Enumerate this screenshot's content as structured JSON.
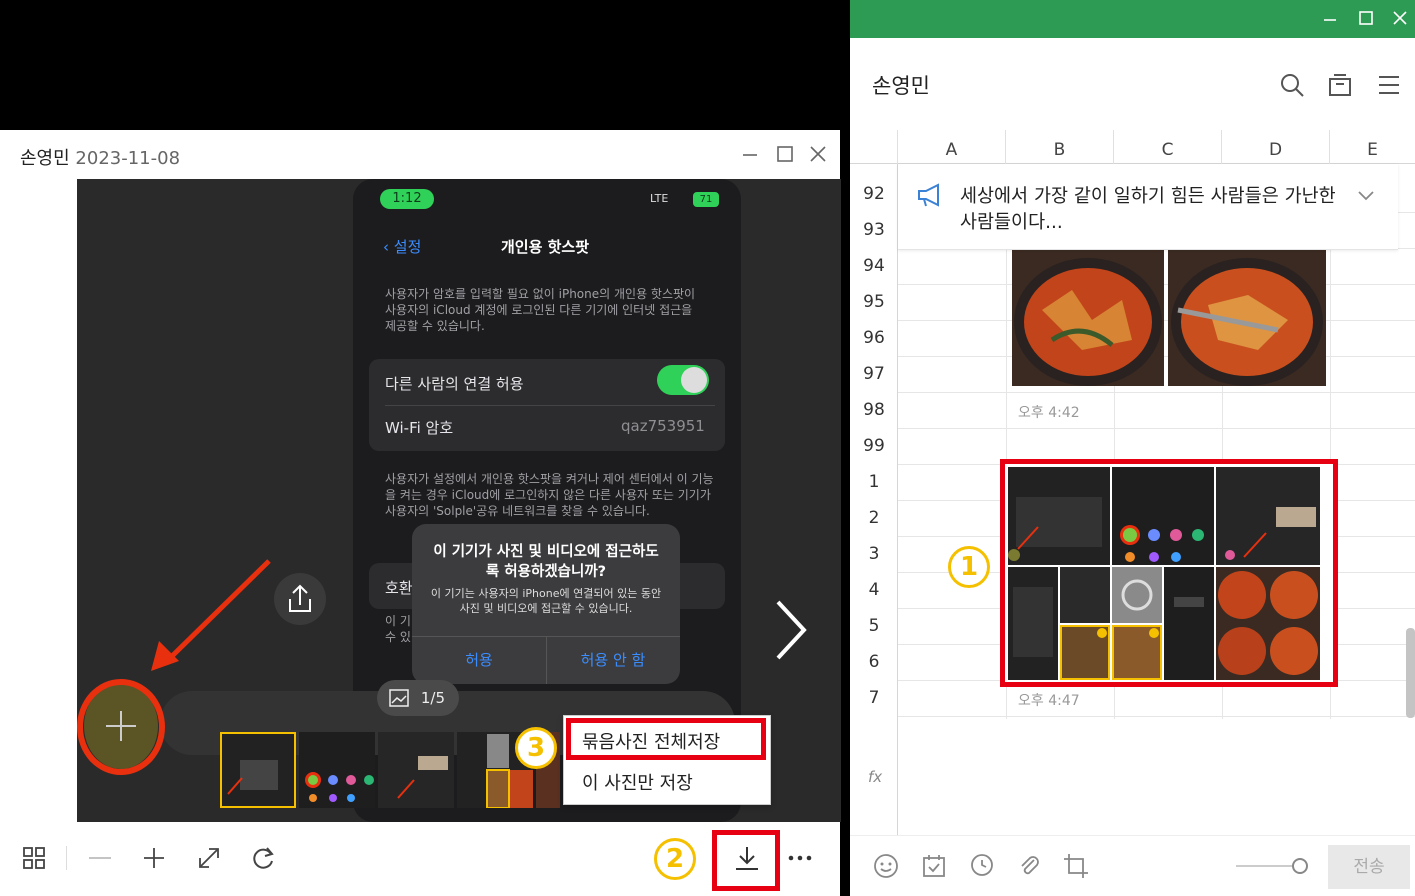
{
  "chat": {
    "name": "손영민",
    "columns": [
      "A",
      "B",
      "C",
      "D",
      "E"
    ],
    "rows": [
      "92",
      "93",
      "94",
      "95",
      "96",
      "97",
      "98",
      "99",
      "1",
      "2",
      "3",
      "4",
      "5",
      "6",
      "7"
    ],
    "notice": "세상에서 가장 같이 일하기 힘든 사람들은 가난한 사람들이다...",
    "time1": "오후 4:42",
    "time2": "오후 4:47",
    "formula_label": "fx",
    "send_label": "전송",
    "marker": "1"
  },
  "viewer": {
    "name": "손영민",
    "date": "2023-11-08",
    "counter": "1/5",
    "marker2": "2",
    "marker3": "3",
    "menu": [
      "묶음사진 전체저장",
      "이 사진만 저장"
    ],
    "phone": {
      "time": "1:12",
      "network": "LTE",
      "battery": "71",
      "back": "설정",
      "title": "개인용 핫스팟",
      "desc1": "사용자가 암호를 입력할 필요 없이 iPhone의 개인용 핫스팟이 사용자의 iCloud 계정에 로그인된 다른 기기에 인터넷 접근을 제공할 수 있습니다.",
      "row1": "다른 사람의 연결 허용",
      "row2": "Wi-Fi 암호",
      "row2_value": "qaz753951",
      "desc2": "사용자가 설정에서 개인용 핫스팟을 켜거나 제어 센터에서 이 기능을 켜는 경우 iCloud에 로그인하지 않은 다른 사용자 또는 기기가 사용자의 'Solple'공유 네트워크를 찾을 수 있습니다.",
      "row3": "호환",
      "desc3": "이 기",
      "desc3b": "수 있",
      "alert_title": "이 기기가 사진 및 비디오에 접근하도록 허용하겠습니까?",
      "alert_body": "이 기기는 사용자의 iPhone에 연결되어 있는 동안 사진 및 비디오에 접근할 수 있습니다.",
      "allow": "허용",
      "deny": "허용 안 함"
    }
  },
  "colors": {
    "chat_green": "#2e9b54",
    "highlight_red": "#e60012",
    "marker_yellow": "#f5c000",
    "arrow_red": "#e8300f"
  }
}
